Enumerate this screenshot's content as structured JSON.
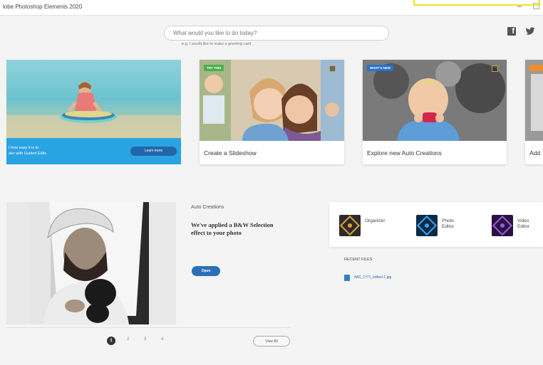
{
  "window": {
    "title": "lobe Photoshop Elements 2020"
  },
  "search": {
    "placeholder": "What would you like to do today?",
    "hint": "e.g. I would like to make a greeting card"
  },
  "social": {
    "facebook_glyph": "f"
  },
  "hero_cards": [
    {
      "text": "t how easy it is to\nake with Guided Edits",
      "button_label": "Learn more"
    },
    {
      "badge": "TRY THIS",
      "badge_color": "#4caf50",
      "label": "Create a Slideshow"
    },
    {
      "badge": "WHAT'S NEW",
      "badge_color": "#2a70c9",
      "label": "Explore new Auto Creations"
    },
    {
      "label": "Add"
    }
  ],
  "auto_creation": {
    "heading": "Auto Creations",
    "description": "We've applied a B&W Selection effect to your photo",
    "open_label": "Open"
  },
  "pagination": {
    "pages": [
      "1",
      "2",
      "3",
      "4"
    ],
    "active": "1",
    "view_all_label": "View All"
  },
  "apps": [
    {
      "label": "Organizer",
      "icon": "organizer-icon",
      "color": "#e2a13b"
    },
    {
      "label": "Photo\nEditor",
      "icon": "photo-editor-icon",
      "color": "#31a8ff"
    },
    {
      "label": "Video\nEditor",
      "icon": "video-editor-icon",
      "color": "#9a5ce0"
    }
  ],
  "recent_files": {
    "heading": "RECENT FILES",
    "items": [
      {
        "name": "IMG_1771_edited-1.jpg"
      }
    ]
  }
}
